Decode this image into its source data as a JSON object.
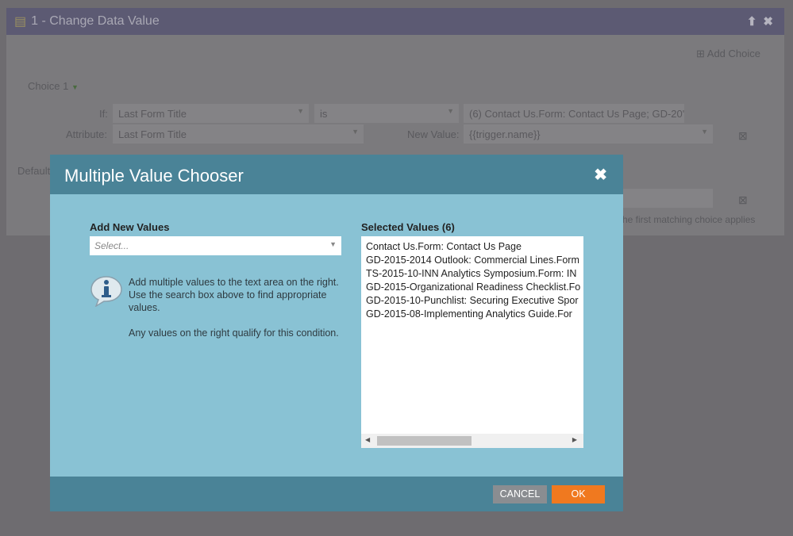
{
  "panel": {
    "title": "1 - Change Data Value",
    "add_choice": "Add Choice",
    "choice_label": "Choice 1",
    "if_label": "If:",
    "if_field": "Last Form Title",
    "operator": "is",
    "if_value": "(6) Contact Us.Form: Contact Us Page; GD-20'",
    "attribute_label": "Attribute:",
    "attribute_field": "Last Form Title",
    "new_value_label": "New Value:",
    "new_value": "{{trigger.name}}",
    "default_label": "Default",
    "footnote": "he first matching choice applies"
  },
  "dialog": {
    "title": "Multiple Value Chooser",
    "add_new_label": "Add New Values",
    "select_placeholder": "Select...",
    "info_text": "Add multiple values to the text area on the right. Use the search box above to find appropriate values.",
    "info_text2": "Any values on the right qualify for this condition.",
    "selected_label": "Selected Values (6)",
    "selected_values": [
      "Contact Us.Form: Contact Us Page",
      "GD-2015-2014 Outlook: Commercial Lines.Form",
      "TS-2015-10-INN Analytics Symposium.Form: IN",
      "GD-2015-Organizational Readiness Checklist.Fo",
      "GD-2015-10-Punchlist: Securing Executive Spor",
      "GD-2015-08-Implementing Analytics Guide.For"
    ],
    "cancel_label": "CANCEL",
    "ok_label": "OK"
  },
  "colors": {
    "dialog_header": "#4a8397",
    "dialog_body": "#89c2d4",
    "ok": "#f0791f",
    "cancel": "#8a8d91"
  }
}
